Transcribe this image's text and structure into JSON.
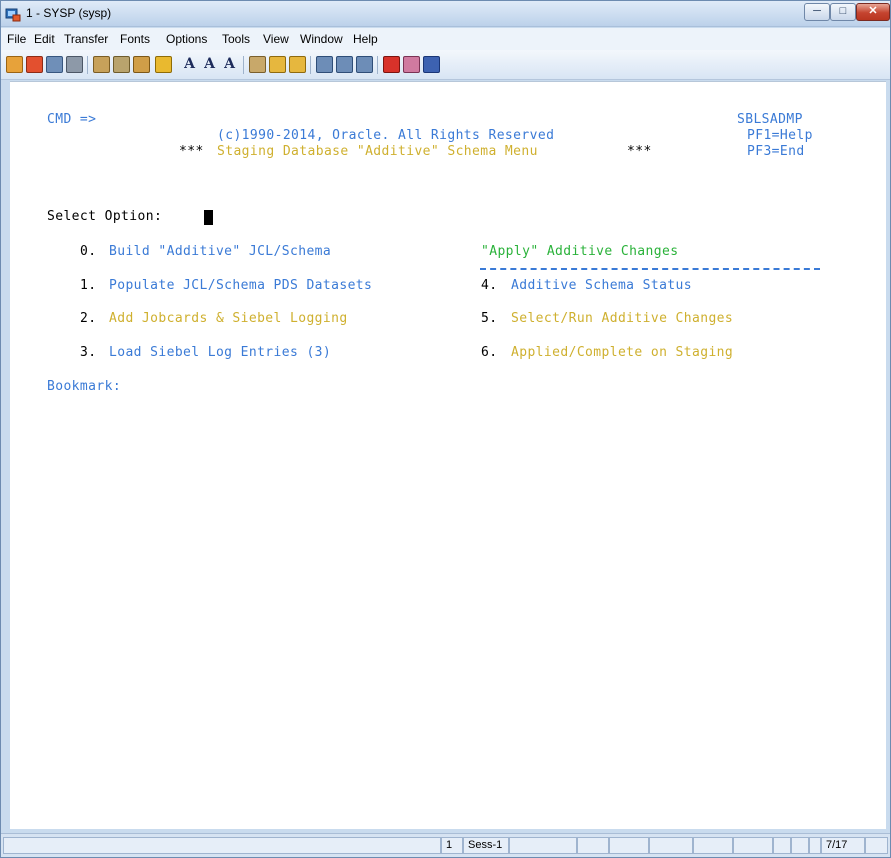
{
  "window": {
    "title": "1 - SYSP (sysp)"
  },
  "menu": [
    "File",
    "Edit",
    "Transfer",
    "Fonts",
    "Options",
    "Tools",
    "View",
    "Window",
    "Help"
  ],
  "toolbar": {
    "icons": [
      "open-session-icon",
      "new-session-icon",
      "save-icon",
      "print-icon",
      "cut-icon",
      "copy-icon",
      "paste-icon",
      "transfer-icon",
      "font-size-icon",
      "font-larger-icon",
      "font-plus-icon",
      "settings-icon",
      "send-file-icon",
      "receive-file-icon",
      "pf1-key-icon",
      "pf2-key-icon",
      "pf3-key-icon",
      "enter-key-icon",
      "clear-icon",
      "help-book-icon"
    ],
    "font_glyph": "A"
  },
  "screen": {
    "cmd_label": "CMD =>",
    "copyright": "(c)1990-2014, Oracle. All Rights Reserved",
    "title_prefix": "***",
    "title": "Staging Database \"Additive\" Schema Menu",
    "title_suffix": "***",
    "program_id": "SBLSADMP",
    "pf1": "PF1=Help",
    "pf3": "PF3=End",
    "select_label": "Select Option:",
    "options_left": [
      {
        "num": "0.",
        "text": "Build \"Additive\" JCL/Schema"
      },
      {
        "num": "1.",
        "text": "Populate JCL/Schema PDS Datasets"
      },
      {
        "num": "2.",
        "text": "Add Jobcards & Siebel Logging"
      },
      {
        "num": "3.",
        "text": "Load Siebel Log Entries (3)"
      }
    ],
    "apply_header": "\"Apply\" Additive Changes",
    "options_right": [
      {
        "num": "4.",
        "text": "Additive Schema Status"
      },
      {
        "num": "5.",
        "text": "Select/Run Additive Changes"
      },
      {
        "num": "6.",
        "text": "Applied/Complete on Staging"
      }
    ],
    "bookmark_label": "Bookmark:"
  },
  "status": {
    "session_num": "1",
    "session_name": "Sess-1",
    "cursor_pos": "7/17"
  },
  "colors": {
    "blue": "#3a7ad6",
    "yellow": "#cfb02f",
    "green": "#2ab23a"
  }
}
